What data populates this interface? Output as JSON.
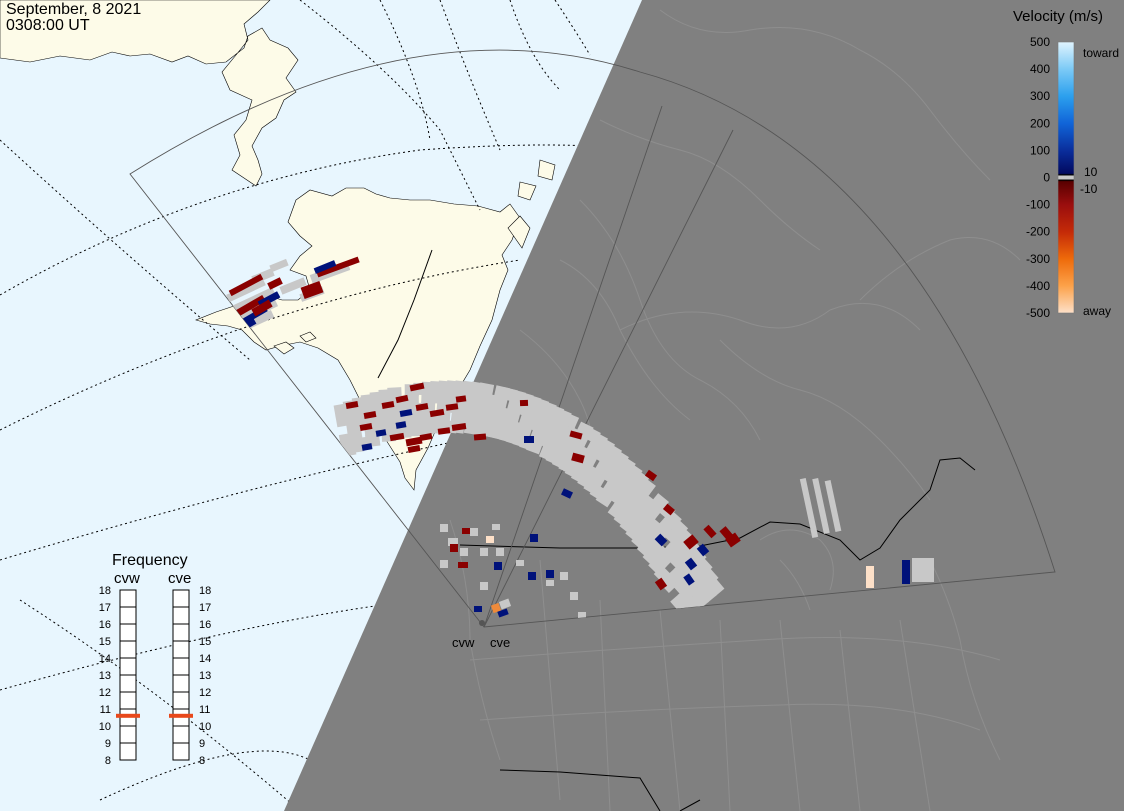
{
  "header": {
    "date": "September, 8 2021",
    "time": "0308:00 UT"
  },
  "colorbar": {
    "title": "Velocity (m/s)",
    "ticks": [
      "500",
      "400",
      "300",
      "200",
      "100",
      "0",
      "-100",
      "-200",
      "-300",
      "-400",
      "-500"
    ],
    "label_toward": "toward",
    "label_away": "away",
    "label_pos": "10",
    "label_neg": "-10"
  },
  "frequency": {
    "title": "Frequency",
    "radars": [
      {
        "name": "cvw",
        "value_mhz": 10.6
      },
      {
        "name": "cve",
        "value_mhz": 10.6
      }
    ],
    "ticks": [
      "18",
      "17",
      "16",
      "15",
      "14",
      "13",
      "12",
      "11",
      "10",
      "9",
      "8"
    ],
    "range": [
      8,
      18
    ],
    "marker_color": "#e8481b"
  },
  "radars": [
    {
      "name": "cvw"
    },
    {
      "name": "cve"
    }
  ],
  "colors": {
    "ocean": "#e8f6fe",
    "land": "#fdfbe8",
    "night": "#808080",
    "night_borders": "#8e8e8e",
    "groundscatter": "#c8c8c8",
    "toward_max": "#e0f4fe",
    "away_max": "#fde0c8"
  },
  "icons": {
    "radar_site": "dot-icon"
  }
}
